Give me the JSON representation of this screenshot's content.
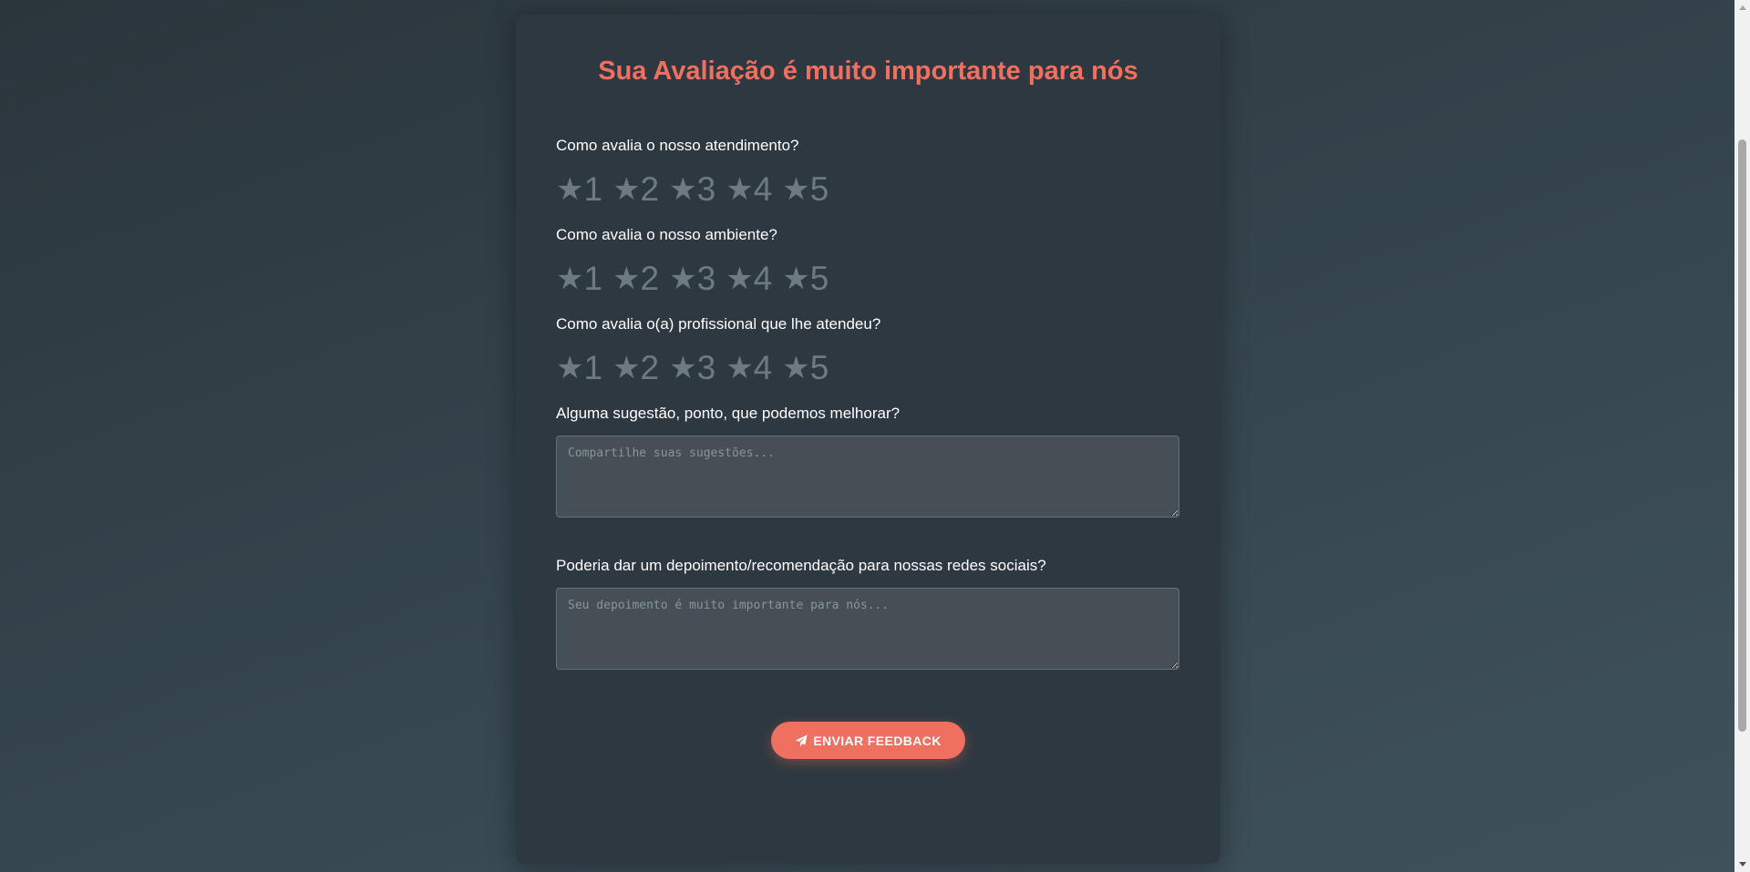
{
  "form": {
    "title": "Sua Avaliação é muito importante para nós",
    "questions": [
      {
        "label": "Como avalia o nosso atendimento?"
      },
      {
        "label": "Como avalia o nosso ambiente?"
      },
      {
        "label": "Como avalia o(a) profissional que lhe atendeu?"
      }
    ],
    "rating_options": [
      "1",
      "2",
      "3",
      "4",
      "5"
    ],
    "star_glyph": "★",
    "suggestion": {
      "label": "Alguma sugestão, ponto, que podemos melhorar?",
      "placeholder": "Compartilhe suas sugestões...",
      "value": ""
    },
    "testimonial": {
      "label": "Poderia dar um depoimento/recomendação para nossas redes sociais?",
      "placeholder": "Seu depoimento é muito importante para nós...",
      "value": ""
    },
    "submit_label": "ENVIAR FEEDBACK"
  },
  "colors": {
    "accent": "#f07060",
    "card": "#2d3840",
    "star_inactive": "#6e7a82"
  },
  "icons": {
    "submit": "paper-plane-icon",
    "rating": "star-icon"
  }
}
